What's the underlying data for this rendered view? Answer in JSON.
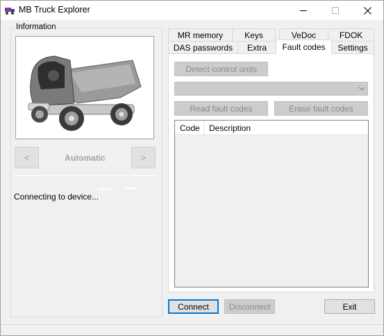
{
  "window": {
    "title": "MB Truck Explorer",
    "controls": {
      "minimize": "minimize",
      "maximize": "maximize",
      "close": "close"
    }
  },
  "info": {
    "group_label": "Information",
    "prev_label": "<",
    "next_label": ">",
    "mode": "Automatic",
    "status": "Connecting to device..."
  },
  "tabs": {
    "row1": [
      "MR memory",
      "Keys",
      "VeDoc",
      "FDOK"
    ],
    "row2": [
      "DAS passwords",
      "Extra",
      "Fault codes",
      "Settings"
    ],
    "active": "Fault codes"
  },
  "fault_codes": {
    "detect_label": "Detect control units",
    "unit_select_value": "",
    "read_label": "Read fault codes",
    "erase_label": "Erase fault codes",
    "columns": [
      "Code",
      "Description"
    ],
    "rows": []
  },
  "footer": {
    "connect_label": "Connect",
    "disconnect_label": "Disconnect",
    "exit_label": "Exit"
  },
  "colors": {
    "window_bg": "#f0f0f0",
    "focus_border": "#0078d7",
    "disabled_bg": "#cccccc"
  }
}
